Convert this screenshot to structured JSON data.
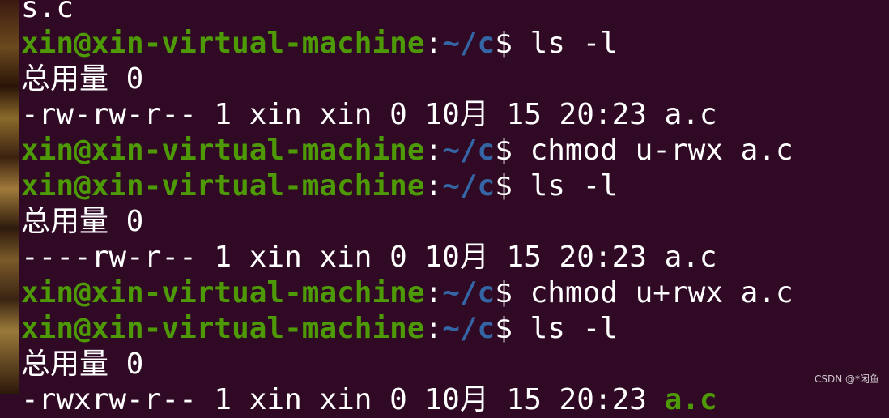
{
  "prompt": {
    "user_host": "xin@xin-virtual-machine",
    "sep": ":",
    "path": "~/c",
    "symbol": "$ "
  },
  "lines": [
    {
      "kind": "output",
      "text": "s.c"
    },
    {
      "kind": "prompt",
      "cmd": "ls -l"
    },
    {
      "kind": "output",
      "text": "总用量 0"
    },
    {
      "kind": "output",
      "text": "-rw-rw-r-- 1 xin xin 0 10月 15 20:23 a.c"
    },
    {
      "kind": "prompt",
      "cmd": "chmod u-rwx a.c"
    },
    {
      "kind": "prompt",
      "cmd": "ls -l"
    },
    {
      "kind": "output",
      "text": "总用量 0"
    },
    {
      "kind": "output",
      "text": "----rw-r-- 1 xin xin 0 10月 15 20:23 a.c"
    },
    {
      "kind": "prompt",
      "cmd": "chmod u+rwx a.c"
    },
    {
      "kind": "prompt",
      "cmd": "ls -l"
    },
    {
      "kind": "output",
      "text": "总用量 0"
    },
    {
      "kind": "exec",
      "text": "-rwxrw-r-- 1 xin xin 0 10月 15 20:23 ",
      "file": "a.c"
    }
  ],
  "watermark": "CSDN @*闲鱼"
}
